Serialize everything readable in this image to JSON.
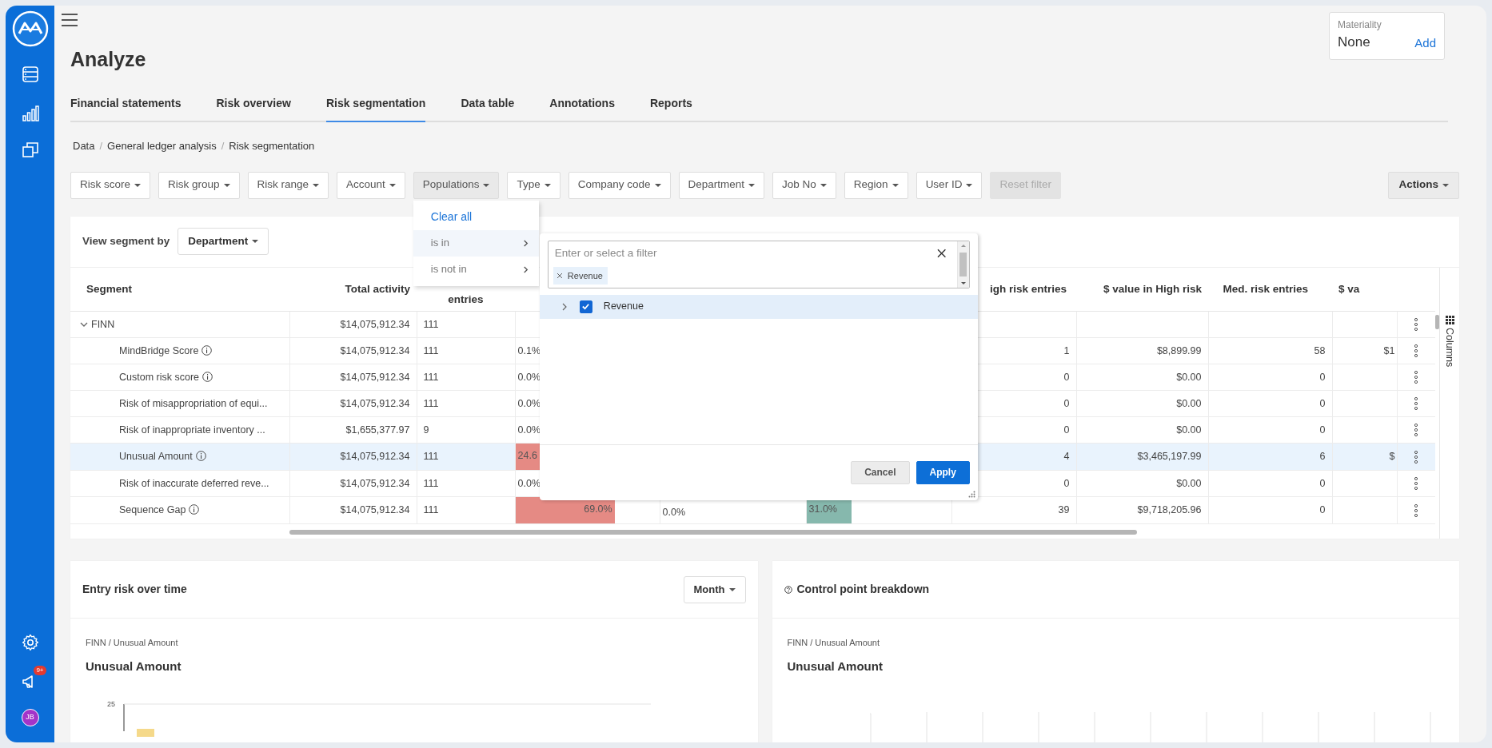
{
  "sidebar": {
    "notification_badge": "9+",
    "avatar_initials": "JB"
  },
  "page_title": "Analyze",
  "materiality": {
    "label": "Materiality",
    "value": "None",
    "action": "Add"
  },
  "tabs": [
    {
      "label": "Financial statements",
      "selected": false
    },
    {
      "label": "Risk overview",
      "selected": false
    },
    {
      "label": "Risk segmentation",
      "selected": true
    },
    {
      "label": "Data table",
      "selected": false
    },
    {
      "label": "Annotations",
      "selected": false
    },
    {
      "label": "Reports",
      "selected": false
    }
  ],
  "breadcrumb": [
    {
      "label": "Data",
      "kind": "link",
      "separator": "/"
    },
    {
      "label": "General ledger analysis",
      "kind": "link",
      "separator": "/"
    },
    {
      "label": "Risk segmentation",
      "kind": "current"
    }
  ],
  "filters": [
    {
      "label": "Risk score",
      "kind": "dropdown",
      "open": false,
      "disabled": false
    },
    {
      "label": "Risk group",
      "kind": "dropdown",
      "open": false,
      "disabled": false
    },
    {
      "label": "Risk range",
      "kind": "dropdown",
      "open": false,
      "disabled": false
    },
    {
      "label": "Account",
      "kind": "dropdown",
      "open": false,
      "disabled": false
    },
    {
      "label": "Populations",
      "kind": "dropdown",
      "open": true,
      "disabled": false
    },
    {
      "label": "Type",
      "kind": "dropdown",
      "open": false,
      "disabled": false
    },
    {
      "label": "Company code",
      "kind": "dropdown",
      "open": false,
      "disabled": false
    },
    {
      "label": "Department",
      "kind": "dropdown",
      "open": false,
      "disabled": false
    },
    {
      "label": "Job No",
      "kind": "dropdown",
      "open": false,
      "disabled": false
    },
    {
      "label": "Region",
      "kind": "dropdown",
      "open": false,
      "disabled": false
    },
    {
      "label": "User ID",
      "kind": "dropdown",
      "open": false,
      "disabled": false
    },
    {
      "label": "Reset filter",
      "kind": "plain",
      "open": false,
      "disabled": true
    }
  ],
  "actions_button": "Actions",
  "populations_menu": [
    {
      "label": "Clear all",
      "kind": "action",
      "selected": false
    },
    {
      "label": "is in",
      "kind": "submenu",
      "selected": true
    },
    {
      "label": "is not in",
      "kind": "submenu",
      "selected": false
    }
  ],
  "filter_popup": {
    "placeholder": "Enter or select a filter",
    "tags": [
      "Revenue"
    ],
    "options": [
      {
        "label": "Revenue",
        "checked": true,
        "selected": true,
        "expanded": false
      }
    ],
    "buttons": [
      {
        "label": "Cancel",
        "kind": "secondary"
      },
      {
        "label": "Apply",
        "kind": "primary"
      }
    ]
  },
  "segment_view": {
    "label": "View segment by",
    "value": "Department"
  },
  "table": {
    "columns": [
      "Segment",
      "Total activity",
      "entries",
      null,
      null,
      null,
      "igh risk entries",
      "$ value in High risk",
      "Med. risk entries",
      "$ va"
    ],
    "rows": [
      {
        "has_info": false,
        "expanded": true,
        "selected": false,
        "cells": [
          "FINN",
          "$14,075,912.34",
          "111",
          null,
          null,
          null,
          null,
          null,
          null,
          null
        ],
        "children": [
          {
            "has_info": true,
            "selected": false,
            "cells": [
              "MindBridge Score",
              "$14,075,912.34",
              "111",
              "0.1%",
              null,
              null,
              "1",
              "$8,899.99",
              "58",
              "$1"
            ]
          },
          {
            "has_info": true,
            "selected": false,
            "cells": [
              "Custom risk score",
              "$14,075,912.34",
              "111",
              "0.0%",
              null,
              null,
              "0",
              "$0.00",
              "0",
              null
            ]
          },
          {
            "has_info": false,
            "selected": false,
            "cells": [
              "Risk of misappropriation of equi...",
              "$14,075,912.34",
              "111",
              "0.0%",
              null,
              null,
              "0",
              "$0.00",
              "0",
              null
            ]
          },
          {
            "has_info": false,
            "selected": false,
            "cells": [
              "Risk of inappropriate inventory ...",
              "$1,655,377.97",
              "9",
              "0.0%",
              null,
              null,
              "0",
              "$0.00",
              "0",
              null
            ]
          },
          {
            "has_info": true,
            "selected": true,
            "cells": [
              "Unusual Amount",
              "$14,075,912.34",
              "111",
              {
                "text": "24.6",
                "level": 0.246,
                "color": "#e58a84"
              },
              null,
              null,
              "4",
              "$3,465,197.99",
              "6",
              "$"
            ]
          },
          {
            "has_info": false,
            "selected": false,
            "cells": [
              "Risk of inaccurate deferred reve...",
              "$14,075,912.34",
              "111",
              "0.0%",
              null,
              null,
              "0",
              "$0.00",
              "0",
              null
            ]
          },
          {
            "has_info": true,
            "selected": false,
            "cells": [
              "Sequence Gap",
              "$14,075,912.34",
              "111",
              {
                "text": "69.0%",
                "level": 0.69,
                "color": "#e58a84"
              },
              "0.0%",
              {
                "text": "31.0%",
                "level": 0.31,
                "color": "#86b8ad"
              },
              "39",
              "$9,718,205.96",
              "0",
              null
            ]
          }
        ]
      }
    ]
  },
  "columns_panel_label": "Columns",
  "bottom_cards": [
    {
      "title": "Entry risk over time",
      "kind": "timeline",
      "period": "Month",
      "path": "FINN / Unusual Amount",
      "subtitle": "Unusual Amount",
      "y_tick": "25"
    },
    {
      "title": "Control point breakdown",
      "kind": "breakdown",
      "path": "FINN / Unusual Amount",
      "subtitle": "Unusual Amount"
    }
  ]
}
